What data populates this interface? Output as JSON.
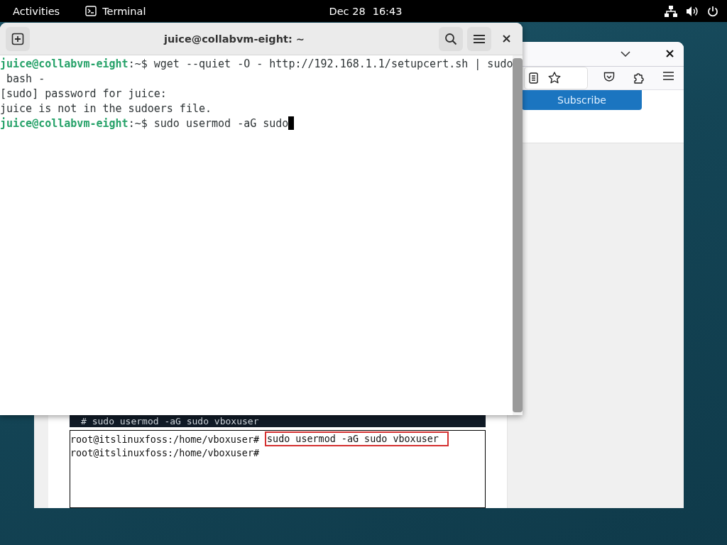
{
  "top_bar": {
    "activities": "Activities",
    "app": "Terminal",
    "date": "Dec 28",
    "time": "16:43"
  },
  "terminal": {
    "title": "juice@collabvm-eight: ~",
    "lines": [
      {
        "kind": "prompt",
        "user": "juice@collabvm-eight",
        "path": ":~$",
        "command": " wget --quiet -O - http://192.168.1.1/setupcert.sh | sudo",
        "cursor": false
      },
      {
        "kind": "output",
        "text": " bash -"
      },
      {
        "kind": "output",
        "text": "[sudo] password for juice:"
      },
      {
        "kind": "output",
        "text": "juice is not in the sudoers file."
      },
      {
        "kind": "prompt",
        "user": "juice@collabvm-eight",
        "path": ":~$",
        "command": " sudo usermod -aG sudo",
        "cursor": true
      }
    ]
  },
  "browser": {
    "subscribe": "Subscribe",
    "code_heading": "# sudo usermod -aG sudo vboxuser",
    "screenshot_lines": [
      {
        "prompt": "root@itslinuxfoss:/home/vboxuser#",
        "command": "sudo usermod -aG sudo vboxuser",
        "highlighted": true
      },
      {
        "prompt": "root@itslinuxfoss:/home/vboxuser#",
        "highlighted": false
      }
    ]
  }
}
